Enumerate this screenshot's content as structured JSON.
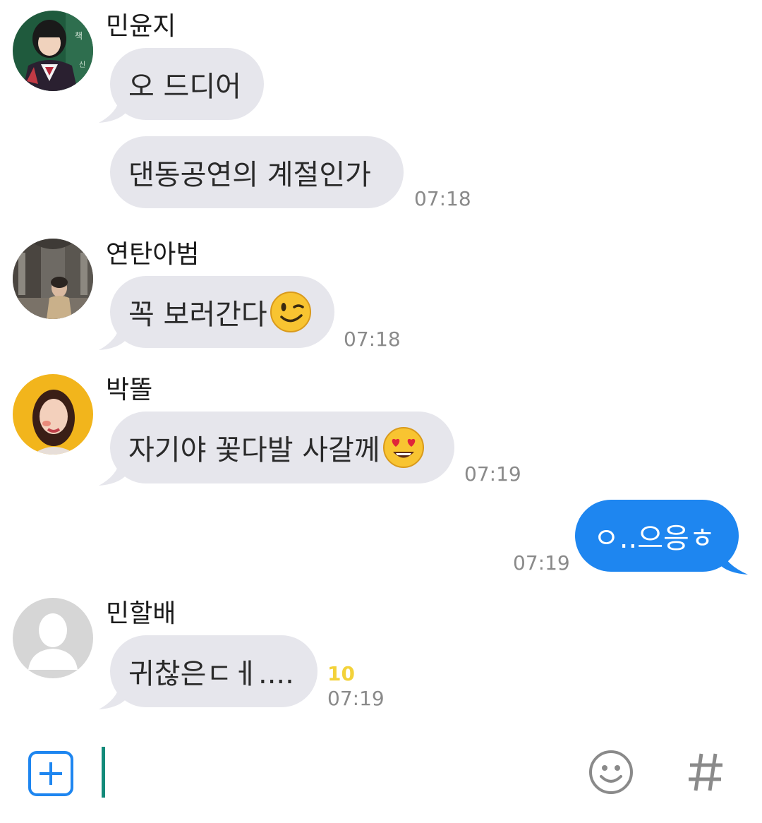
{
  "messages": [
    {
      "sender": "민윤지",
      "bubbles": [
        "오 드디어",
        "댄동공연의 계절인가"
      ],
      "time": "07:18"
    },
    {
      "sender": "연탄아범",
      "text": "꼭 보러간다",
      "emoji": "wink-emoji",
      "time": "07:18"
    },
    {
      "sender": "박똘",
      "text": "자기야 꽃다발 사갈께",
      "emoji": "heart-eyes-emoji",
      "time": "07:19"
    },
    {
      "sender": "me",
      "text": "ㅇ..으응ㅎ",
      "time": "07:19"
    },
    {
      "sender": "민할배",
      "text": "귀찮은ㄷㅔ....",
      "unread": "10",
      "time": "07:19"
    }
  ],
  "input": {
    "value": ""
  },
  "colors": {
    "incoming_bubble": "#e6e6ec",
    "outgoing_bubble": "#1e86f0",
    "unread": "#f3d23a",
    "accent": "#1e86f0",
    "cursor": "#138a7a"
  },
  "icons": {
    "attach": "plus-square-icon",
    "emoji": "smiley-icon",
    "hashtag": "hashtag-icon"
  }
}
